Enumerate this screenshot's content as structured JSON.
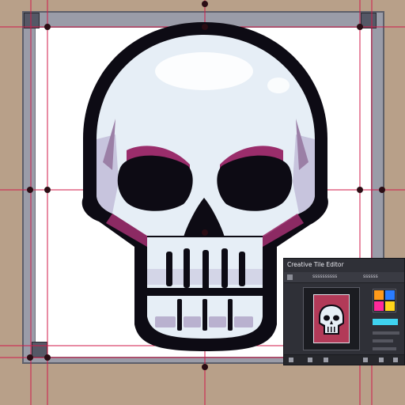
{
  "colors": {
    "background": "#b8a089",
    "artboard": "#ffffff",
    "guides": "#d11a4a",
    "skull_fill": "#e6eef6",
    "skull_shadow": "#9b7fa6",
    "skull_accent": "#9a2d6b",
    "outline": "#0d0b14",
    "panel_bg": "#2f3037"
  },
  "icons": {
    "skull": "skull-illustration",
    "preview": "skull-thumbnail"
  },
  "panel": {
    "title": "Creative Tile Editor",
    "row_label": "ssssssssss",
    "row_label_2": "ssssss"
  }
}
